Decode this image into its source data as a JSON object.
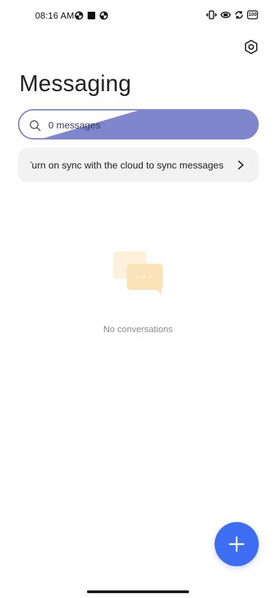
{
  "status_bar": {
    "time": "08:16 AM",
    "battery": "100",
    "left_icons": [
      "data-saver-icon",
      "square-notification-icon",
      "data-saver-icon"
    ],
    "right_icons": [
      "vibrate-icon",
      "hotspot-icon",
      "sync-icon",
      "battery-icon"
    ]
  },
  "header": {
    "title": "Messaging",
    "settings_icon": "gear-icon"
  },
  "search": {
    "text": "0 messages",
    "icon": "search-icon"
  },
  "sync_banner": {
    "text": "Turn on sync with the cloud to sync messages",
    "chevron_icon": "chevron-right-icon"
  },
  "empty_state": {
    "text": "No conversations",
    "icon": "chat-bubbles-icon"
  },
  "fab": {
    "icon": "plus-icon"
  },
  "colors": {
    "accent": "#3d6df2",
    "search_bg": "#7f86cc",
    "banner_bg": "#f2f2f2"
  }
}
